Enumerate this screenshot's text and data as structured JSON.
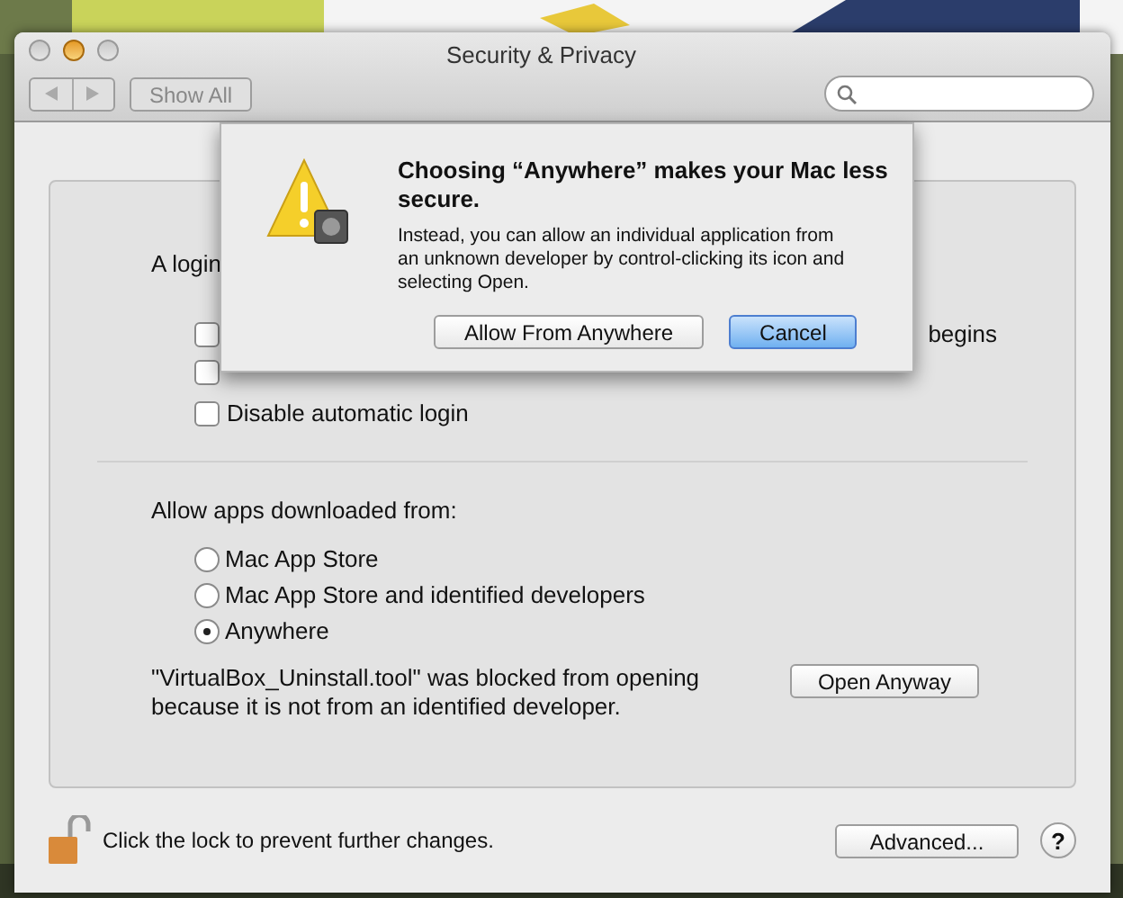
{
  "window": {
    "title": "Security & Privacy"
  },
  "toolbar": {
    "show_all": "Show All"
  },
  "login": {
    "intro": "A login",
    "trailing": "begins",
    "covered_rows": [
      {
        "checked": false
      },
      {
        "checked": false
      }
    ],
    "options": [
      {
        "kind": "checkbox",
        "label": "Disable automatic login",
        "checked": false
      }
    ]
  },
  "gatekeeper": {
    "heading": "Allow apps downloaded from:",
    "sources": [
      {
        "label": "Mac App Store",
        "selected": false
      },
      {
        "label": "Mac App Store and identified developers",
        "selected": false
      },
      {
        "label": "Anywhere",
        "selected": true
      }
    ],
    "blocked_message": "\"VirtualBox_Uninstall.tool\" was blocked from opening because it is not from an identified developer.",
    "open_button": "Open Anyway"
  },
  "footer": {
    "lock_text": "Click the lock to prevent further changes.",
    "advanced_button": "Advanced...",
    "help": "?"
  },
  "alert": {
    "title": "Choosing “Anywhere” makes your Mac less secure.",
    "message": "Instead, you can allow an individual application from an unknown developer by control-clicking its icon and selecting Open.",
    "buttons": [
      {
        "label": "Allow From Anywhere",
        "default": false
      },
      {
        "label": "Cancel",
        "default": true
      }
    ]
  }
}
